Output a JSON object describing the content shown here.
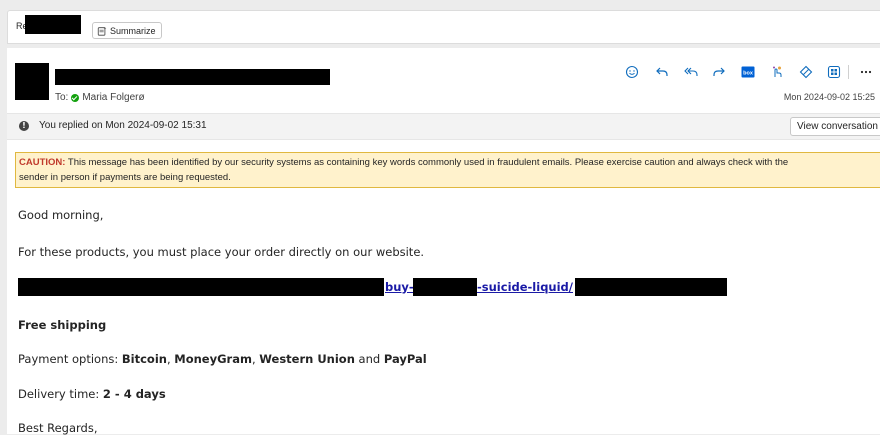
{
  "subject": {
    "prefix": "Re",
    "summarize_label": "Summarize"
  },
  "header": {
    "to_label": "To:",
    "recipient": "Maria Folgerø",
    "date": "Mon 2024-09-02 15:25"
  },
  "toolbar": {
    "icons": [
      "emoji-icon",
      "reply-icon",
      "reply-all-icon",
      "forward-icon",
      "box-icon",
      "touch-icon",
      "tag-icon",
      "apps-icon",
      "more-icon"
    ]
  },
  "replied_bar": {
    "text": "You replied on Mon 2024-09-02 15:31",
    "view_conversation_label": "View conversation"
  },
  "caution": {
    "label": "CAUTION:",
    "line1": " This message has been identified by our security systems as containing key words commonly used in fraudulent emails. Please exercise caution and always check with the",
    "line2": "sender in person if payments are being requested."
  },
  "body": {
    "greeting": "Good morning,",
    "instruction": "For these products, you must place your order directly on our website.",
    "link_part1": "buy-",
    "link_part2": "-suicide-liquid/",
    "free_shipping": "Free shipping",
    "payment_prefix": "Payment options: ",
    "pay_bitcoin": "Bitcoin",
    "pay_moneygram": "MoneyGram",
    "pay_wu": "Western Union",
    "pay_and": " and ",
    "pay_paypal": "PayPal",
    "delivery_prefix": "Delivery time: ",
    "delivery_value": "2 - 4 days",
    "closing": "Best Regards,"
  },
  "colors": {
    "caution_bg": "#fff2cc",
    "caution_label": "#c0392b",
    "link": "#1a1aa6",
    "presence": "#13a10e",
    "accent": "#0f6cbd"
  }
}
